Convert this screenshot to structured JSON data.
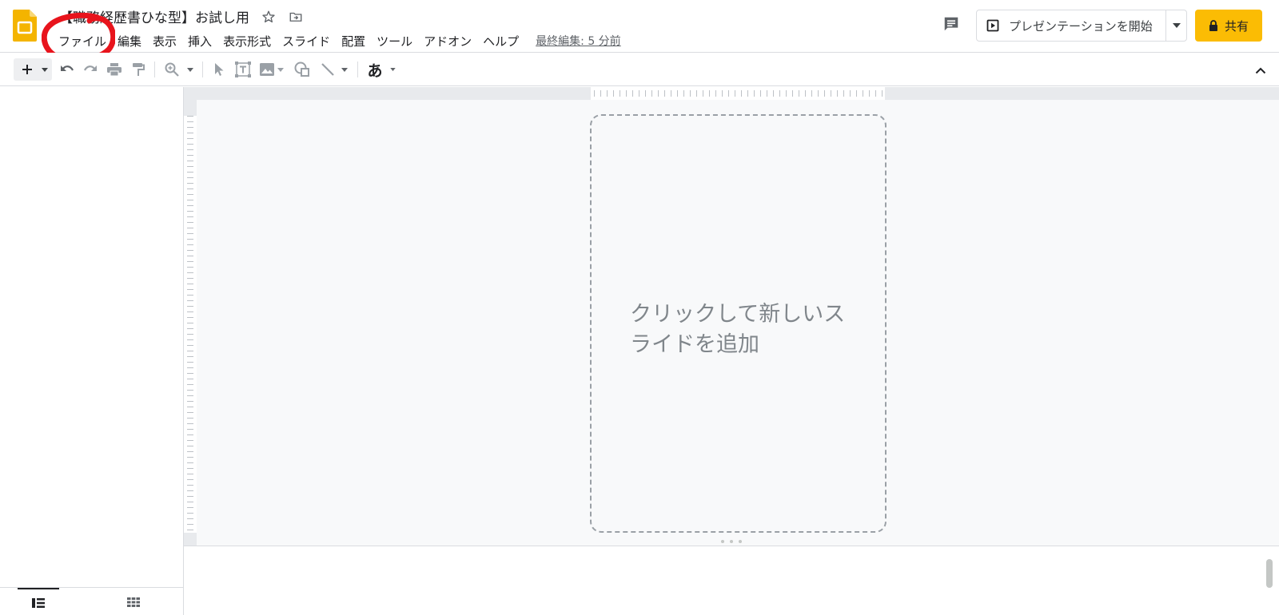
{
  "document": {
    "title": "【職務経歴書ひな型】お試し用",
    "last_edit": "最終編集: 5 分前"
  },
  "menu": {
    "items": [
      "ファイル",
      "編集",
      "表示",
      "挿入",
      "表示形式",
      "スライド",
      "配置",
      "ツール",
      "アドオン",
      "ヘルプ"
    ]
  },
  "header_actions": {
    "present_label": "プレゼンテーションを開始",
    "share_label": "共有"
  },
  "toolbar": {
    "input_tools_glyph": "あ"
  },
  "editor": {
    "placeholder_text": "クリックして新しいスライドを追加"
  },
  "colors": {
    "accent_share": "#fbbc04",
    "slides_brand": "#f4b400",
    "annotation_red": "#e8141c"
  },
  "icons": [
    "slides-logo-icon",
    "star-icon",
    "move-folder-icon",
    "comment-icon",
    "present-icon",
    "lock-icon",
    "new-slide-icon",
    "undo-icon",
    "redo-icon",
    "print-icon",
    "paint-format-icon",
    "zoom-icon",
    "select-icon",
    "text-box-icon",
    "image-icon",
    "shape-icon",
    "line-icon",
    "collapse-icon",
    "filmstrip-view-icon",
    "grid-view-icon"
  ]
}
